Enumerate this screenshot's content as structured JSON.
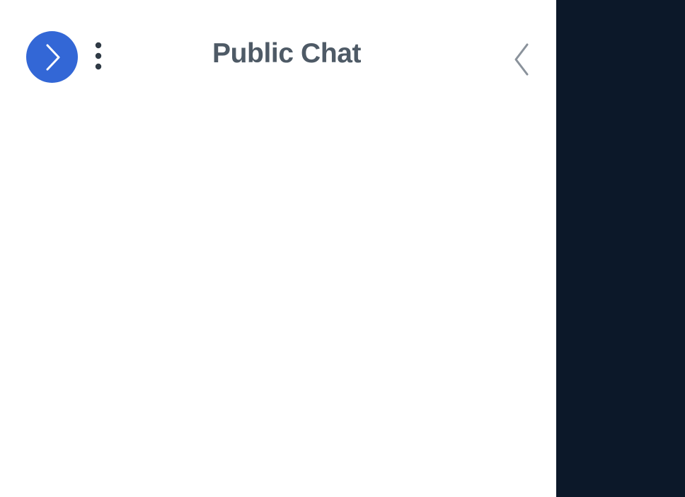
{
  "chat": {
    "title": "Public Chat",
    "expand_icon": "chevron-right-icon",
    "more_icon": "vertical-ellipsis-icon",
    "collapse_icon": "chevron-left-icon"
  },
  "colors": {
    "panel_background": "#ffffff",
    "accent_button": "#3367d6",
    "accent_icon": "#ffffff",
    "title_text": "#4e5a66",
    "more_icon": "#2f3a45",
    "collapse_icon": "#8a929b",
    "side_pane_background": "#0c1829"
  }
}
